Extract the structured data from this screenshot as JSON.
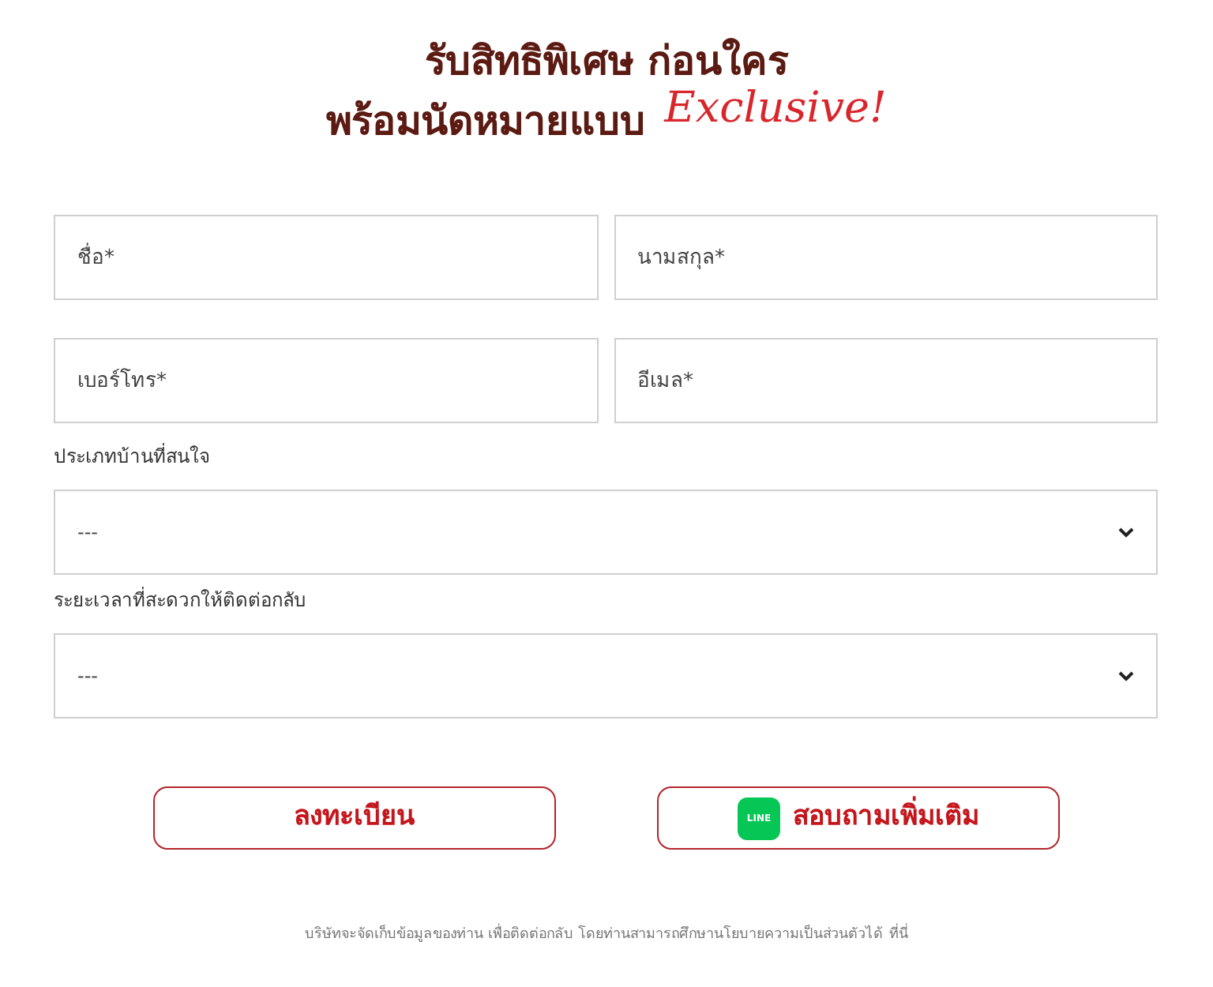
{
  "heading": {
    "line_1": "รับสิทธิพิเศษ ก่อนใคร",
    "line_2": "พร้อมนัดหมายแบบ",
    "accent": "Exclusive!"
  },
  "fields": [
    {
      "placeholder": "ชื่อ*"
    },
    {
      "placeholder": "นามสกุล*"
    },
    {
      "placeholder": "เบอร์โทร*"
    },
    {
      "placeholder": "อีเมล*"
    }
  ],
  "selects": [
    {
      "label": "ประเภทบ้านที่สนใจ",
      "value": "---"
    },
    {
      "label": "ระยะเวลาที่สะดวกให้ติดต่อกลับ",
      "value": "---"
    }
  ],
  "buttons": [
    {
      "kind": "plain",
      "label": "ลงทะเบียน"
    },
    {
      "kind": "line",
      "label": "สอบถามเพิ่มเติม",
      "logo_text": "LINE"
    }
  ],
  "footer": {
    "text": "บริษัทจะจัดเก็บข้อมูลของท่าน เพื่อติดต่อกลับ โดยท่านสามารถศึกษานโยบายความเป็นส่วนตัวได้",
    "link": "ที่นี่"
  }
}
